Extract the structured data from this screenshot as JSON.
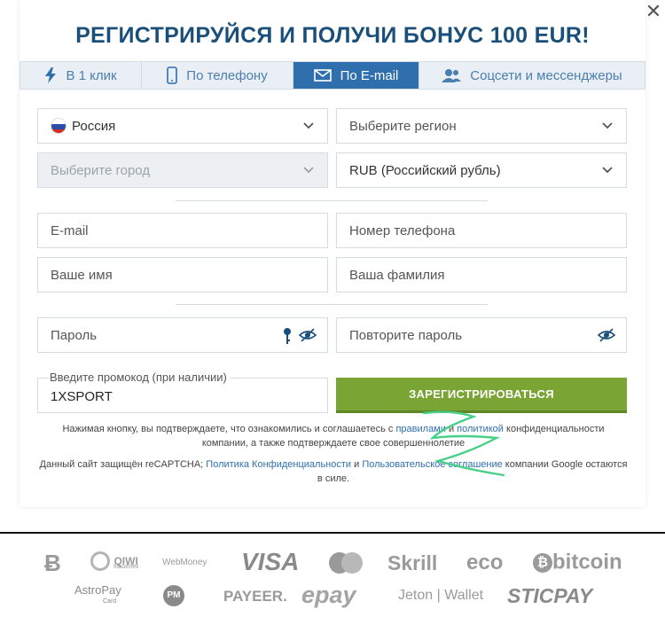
{
  "title": "РЕГИСТРИРУЙСЯ И ПОЛУЧИ БОНУС 100 EUR!",
  "tabs": [
    {
      "label": "В 1 клик",
      "icon": "lightning-icon"
    },
    {
      "label": "По телефону",
      "icon": "phone-icon"
    },
    {
      "label": "По E-mail",
      "icon": "envelope-icon",
      "active": true
    },
    {
      "label": "Соцсети и мессенджеры",
      "icon": "people-icon"
    }
  ],
  "form": {
    "country": "Россия",
    "region_placeholder": "Выберите регион",
    "city_placeholder": "Выберите город",
    "currency": "RUB (Российский рубль)",
    "email_placeholder": "E-mail",
    "phone_placeholder": "Номер телефона",
    "first_name_placeholder": "Ваше имя",
    "last_name_placeholder": "Ваша фамилия",
    "password_placeholder": "Пароль",
    "password_repeat_placeholder": "Повторите пароль",
    "promo_label": "Введите промокод (при наличии)",
    "promo_value": "1XSPORT",
    "register_label": "ЗАРЕГИСТРИРОВАТЬСЯ"
  },
  "terms": {
    "t1": "Нажимая кнопку, вы подтверждаете, что ознакомились и соглашаетесь с ",
    "link_rules": "правилами",
    "t2": " и ",
    "link_privacy": "политикой",
    "t3": " конфиденциальности компании, а также подтверждаете свое совершеннолетие"
  },
  "recaptcha": {
    "t1": "Данный сайт защищён reCAPTCHA; ",
    "link_privacy": "Политика Конфиденциальности",
    "t2": " и ",
    "link_terms": "Пользовательское соглашение",
    "t3": " компании Google остаются в силе."
  },
  "partners": {
    "qiwi": "QIWI",
    "qiwi_sub": "Кошелек",
    "webmoney": "WebMoney",
    "visa": "VISA",
    "skrill": "Skrill",
    "eco": "eco",
    "bitcoin": "bitcoin",
    "astropay": "AstroPay",
    "astropay_sub": "Card",
    "pm": "PM",
    "payeer": "PAYEER.",
    "epay": "epay",
    "jeton": "Jeton | Wallet",
    "sticpay": "STICPAY"
  },
  "colors": {
    "title": "#1a4f7a",
    "tab_active": "#2f6fae",
    "register": "#7aa433",
    "link": "#2f6fae"
  }
}
